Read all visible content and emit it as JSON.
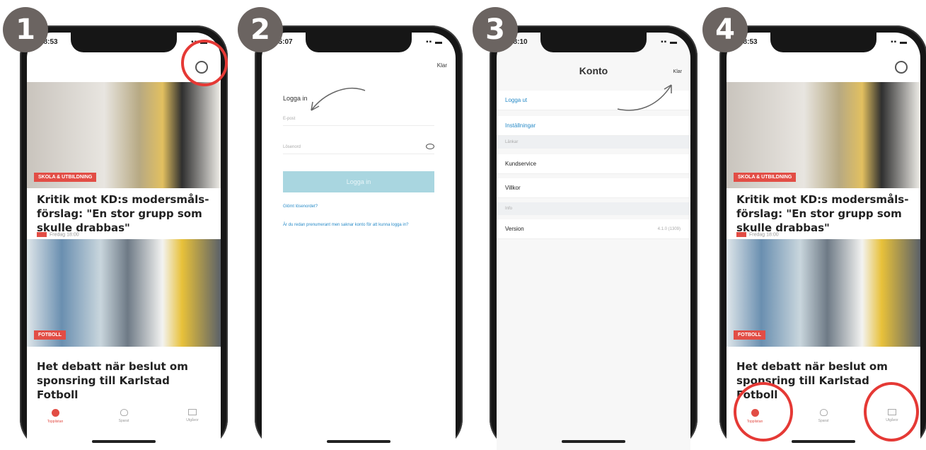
{
  "steps": [
    "1",
    "2",
    "3",
    "4"
  ],
  "status_times": [
    "08:53",
    "15:07",
    "08:10",
    "08:53"
  ],
  "feed": {
    "article1": {
      "tag": "SKOLA & UTBILDNING",
      "headline": "Kritik mot KD:s modersmåls-förslag: \"En stor grupp som skulle drabbas\"",
      "meta": "Fredag 18:00"
    },
    "article2": {
      "tag": "FOTBOLL",
      "headline": "Het debatt när beslut om sponsring till Karlstad Fotboll"
    },
    "tabs": [
      "Topplistan",
      "Sparat",
      "Utgåvor"
    ]
  },
  "login": {
    "done": "Klar",
    "title": "Logga in",
    "email_placeholder": "E-post",
    "password_placeholder": "Lösenord",
    "button": "Logga in",
    "forgot": "Glömt lösenordet?",
    "help": "Är du redan prenumerant men saknar konto för att kunna logga in?"
  },
  "account": {
    "title": "Konto",
    "done": "Klar",
    "logout": "Logga ut",
    "settings": "Inställningar",
    "section_links": "Länkar",
    "customer_service": "Kundservice",
    "terms": "Villkor",
    "section_info": "Info",
    "version_label": "Version",
    "version_value": "4.1.0 (1309)"
  },
  "colors": {
    "accent_red": "#e53935",
    "tag_red": "#e24d45",
    "link_blue": "#2a8cc8",
    "badge_gray": "#6b6461"
  }
}
